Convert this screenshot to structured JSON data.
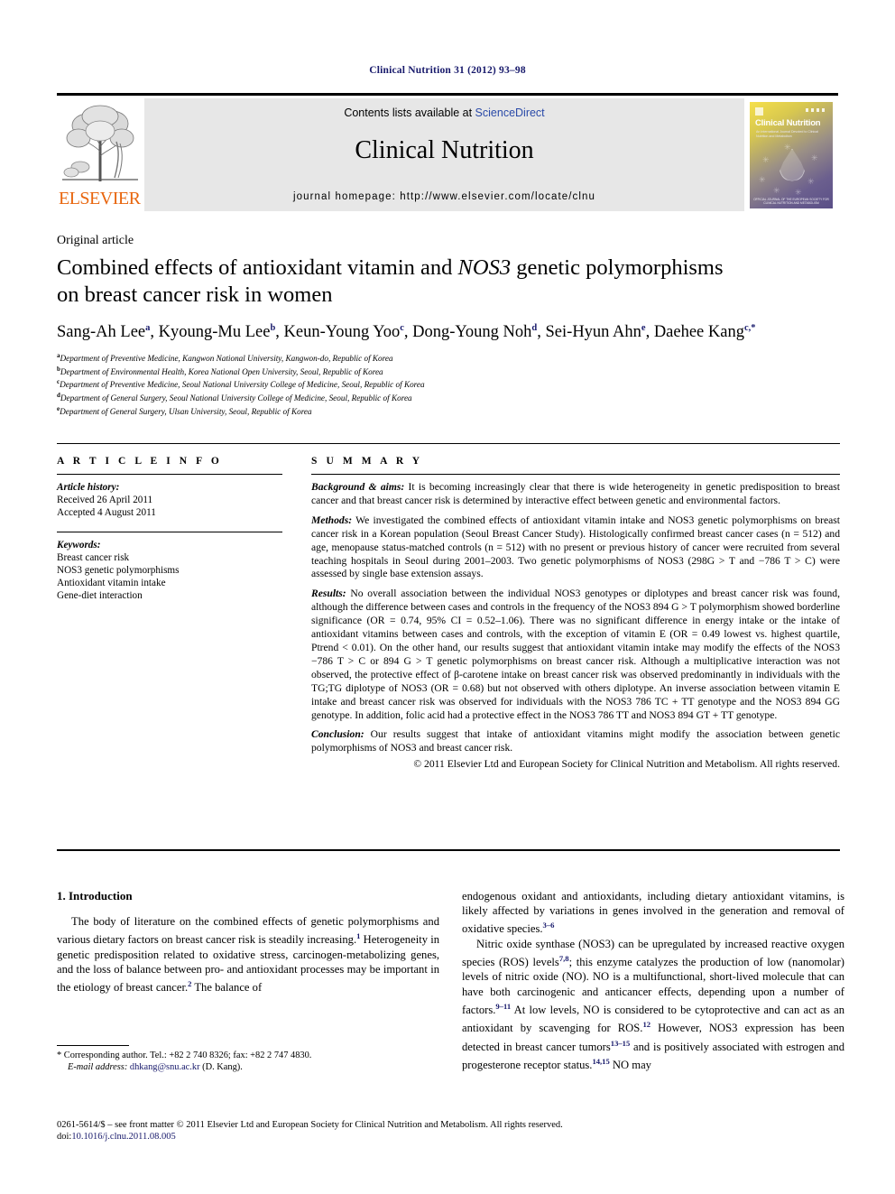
{
  "running_head": "Clinical Nutrition 31 (2012) 93–98",
  "masthead": {
    "publisher_wordmark": "ELSEVIER",
    "contents_prefix": "Contents lists available at ",
    "contents_link": "ScienceDirect",
    "journal_name": "Clinical Nutrition",
    "homepage": "journal homepage: http://www.elsevier.com/locate/clnu",
    "cover": {
      "title": "Clinical Nutrition",
      "subtitle": "An International Journal Devoted to Clinical Nutrition and Metabolism",
      "footer": "OFFICIAL JOURNAL OF THE EUROPEAN SOCIETY FOR CLINICAL NUTRITION AND METABOLISM"
    }
  },
  "article": {
    "category": "Original article",
    "title_line1_a": "Combined effects of antioxidant vitamin and ",
    "title_line1_italic": "NOS3",
    "title_line1_b": " genetic polymorphisms",
    "title_line2": "on breast cancer risk in women",
    "authors": [
      {
        "name": "Sang-Ah Lee",
        "sup": "a",
        "sep": ", "
      },
      {
        "name": "Kyoung-Mu Lee",
        "sup": "b",
        "sep": ", "
      },
      {
        "name": "Keun-Young Yoo",
        "sup": "c",
        "sep": ", "
      },
      {
        "name": "Dong-Young Noh",
        "sup": "d",
        "sep": ", "
      },
      {
        "name": "Sei-Hyun Ahn",
        "sup": "e",
        "sep": ", "
      },
      {
        "name": "Daehee Kang",
        "sup": "c,*",
        "sep": ""
      }
    ],
    "affiliations": [
      {
        "mark": "a",
        "text": "Department of Preventive Medicine, Kangwon National University, Kangwon-do, Republic of Korea"
      },
      {
        "mark": "b",
        "text": "Department of Environmental Health, Korea National Open University, Seoul, Republic of Korea"
      },
      {
        "mark": "c",
        "text": "Department of Preventive Medicine, Seoul National University College of Medicine, Seoul, Republic of Korea"
      },
      {
        "mark": "d",
        "text": "Department of General Surgery, Seoul National University College of Medicine, Seoul, Republic of Korea"
      },
      {
        "mark": "e",
        "text": "Department of General Surgery, Ulsan University, Seoul, Republic of Korea"
      }
    ]
  },
  "article_info": {
    "label": "A R T I C L E  I N F O",
    "history_header": "Article history:",
    "history": [
      "Received 26 April 2011",
      "Accepted 4 August 2011"
    ],
    "keywords_header": "Keywords:",
    "keywords": [
      "Breast cancer risk",
      "NOS3 genetic polymorphisms",
      "Antioxidant vitamin intake",
      "Gene-diet interaction"
    ]
  },
  "summary": {
    "label": "S U M M A R Y",
    "background_label": "Background & aims:",
    "background_text": " It is becoming increasingly clear that there is wide heterogeneity in genetic predisposition to breast cancer and that breast cancer risk is determined by interactive effect between genetic and environmental factors.",
    "methods_label": "Methods:",
    "methods_text": " We investigated the combined effects of antioxidant vitamin intake and NOS3 genetic polymorphisms on breast cancer risk in a Korean population (Seoul Breast Cancer Study). Histologically confirmed breast cancer cases (n = 512) and age, menopause status-matched controls (n = 512) with no present or previous history of cancer were recruited from several teaching hospitals in Seoul during 2001–2003. Two genetic polymorphisms of NOS3 (298G > T and −786 T > C) were assessed by single base extension assays.",
    "results_label": "Results:",
    "results_text": " No overall association between the individual NOS3 genotypes or diplotypes and breast cancer risk was found, although the difference between cases and controls in the frequency of the NOS3 894 G > T polymorphism showed borderline significance (OR = 0.74, 95% CI = 0.52–1.06). There was no significant difference in energy intake or the intake of antioxidant vitamins between cases and controls, with the exception of vitamin E (OR = 0.49 lowest vs. highest quartile, Ptrend < 0.01). On the other hand, our results suggest that antioxidant vitamin intake may modify the effects of the NOS3 −786 T > C or 894 G > T genetic polymorphisms on breast cancer risk. Although a multiplicative interaction was not observed, the protective effect of β-carotene intake on breast cancer risk was observed predominantly in individuals with the TG;TG diplotype of NOS3 (OR = 0.68) but not observed with others diplotype. An inverse association between vitamin E intake and breast cancer risk was observed for individuals with the NOS3 786 TC + TT genotype and the NOS3 894 GG genotype. In addition, folic acid had a protective effect in the NOS3 786 TT and NOS3 894 GT + TT genotype.",
    "conclusion_label": "Conclusion:",
    "conclusion_text": " Our results suggest that intake of antioxidant vitamins might modify the association between genetic polymorphisms of NOS3 and breast cancer risk.",
    "copyright": "© 2011 Elsevier Ltd and European Society for Clinical Nutrition and Metabolism. All rights reserved."
  },
  "introduction": {
    "heading": "1. Introduction",
    "para1_part1": "The body of literature on the combined effects of genetic polymorphisms and various dietary factors on breast cancer risk is steadily increasing.",
    "para1_ref1": "1",
    "para1_part2": " Heterogeneity in genetic predisposition related to oxidative stress, carcinogen-metabolizing genes, and the loss of balance between pro- and antioxidant processes may be important in the etiology of breast cancer.",
    "para1_ref2": "2",
    "para1_part3": " The balance of endogenous oxidant and antioxidants, including dietary antioxidant vitamins, is likely affected by variations in genes involved in the generation and removal of oxidative species.",
    "para1_ref3": "3–6",
    "para2_part1": "Nitric oxide synthase (NOS3) can be upregulated by increased reactive oxygen species (ROS) levels",
    "para2_ref1": "7,8",
    "para2_part2": "; this enzyme catalyzes the production of low (nanomolar) levels of nitric oxide (NO). NO is a multifunctional, short-lived molecule that can have both carcinogenic and anticancer effects, depending upon a number of factors.",
    "para2_ref2": "9–11",
    "para2_part3": " At low levels, NO is considered to be cytoprotective and can act as an antioxidant by scavenging for ROS.",
    "para2_ref3": "12",
    "para2_part4": " However, NOS3 expression has been detected in breast cancer tumors",
    "para2_ref4": "13–15",
    "para2_part5": " and is positively associated with estrogen and progesterone receptor status.",
    "para2_ref5": "14,15",
    "para2_part6": " NO may"
  },
  "footnote": {
    "corresponding": "* Corresponding author. Tel.: +82 2 740 8326; fax: +82 2 747 4830.",
    "email_label": "E-mail address:",
    "email": " dhkang@snu.ac.kr",
    "email_tail": " (D. Kang)."
  },
  "footer": {
    "line1": "0261-5614/$ – see front matter © 2011 Elsevier Ltd and European Society for Clinical Nutrition and Metabolism. All rights reserved.",
    "doi_label": "doi:",
    "doi": "10.1016/j.clnu.2011.08.005"
  }
}
